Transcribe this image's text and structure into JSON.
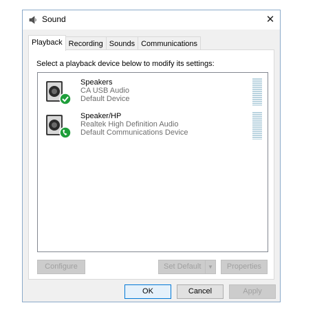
{
  "window": {
    "title": "Sound",
    "close_glyph": "✕"
  },
  "tabs": [
    {
      "label": "Playback",
      "active": true
    },
    {
      "label": "Recording",
      "active": false
    },
    {
      "label": "Sounds",
      "active": false
    },
    {
      "label": "Communications",
      "active": false
    }
  ],
  "playback": {
    "instruction": "Select a playback device below to modify its settings:",
    "devices": [
      {
        "name": "Speakers",
        "driver": "CA USB Audio",
        "status": "Default Device",
        "badge_icon": "green-check-icon",
        "badge_color": "#1e9e3a"
      },
      {
        "name": "Speaker/HP",
        "driver": "Realtek High Definition Audio",
        "status": "Default Communications Device",
        "badge_icon": "green-phone-icon",
        "badge_color": "#1e9e3a"
      }
    ],
    "buttons": {
      "configure": "Configure",
      "set_default": "Set Default",
      "properties": "Properties"
    }
  },
  "footer": {
    "ok": "OK",
    "cancel": "Cancel",
    "apply": "Apply"
  },
  "colors": {
    "accent": "#0078d7",
    "meter": "#b9d3df"
  }
}
